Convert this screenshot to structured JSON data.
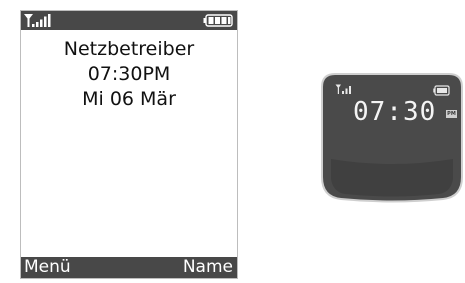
{
  "main_screen": {
    "status": {
      "signal_icon": "signal-strength-icon",
      "battery_icon": "battery-full-icon"
    },
    "operator": "Netzbetreiber",
    "time": "07:30PM",
    "date": "Mi 06 Mär",
    "softkeys": {
      "left": "Menü",
      "right": "Name"
    },
    "colors": {
      "bar": "#484848",
      "background": "#ffffff",
      "text": "#111111"
    }
  },
  "external_display": {
    "signal_icon": "signal-strength-icon",
    "battery_icon": "battery-icon",
    "time": "07:30",
    "ampm": "PM",
    "colors": {
      "screen": "#4a4a4a",
      "bezel": "#cfcfcf",
      "text": "#f4f4f4"
    }
  }
}
